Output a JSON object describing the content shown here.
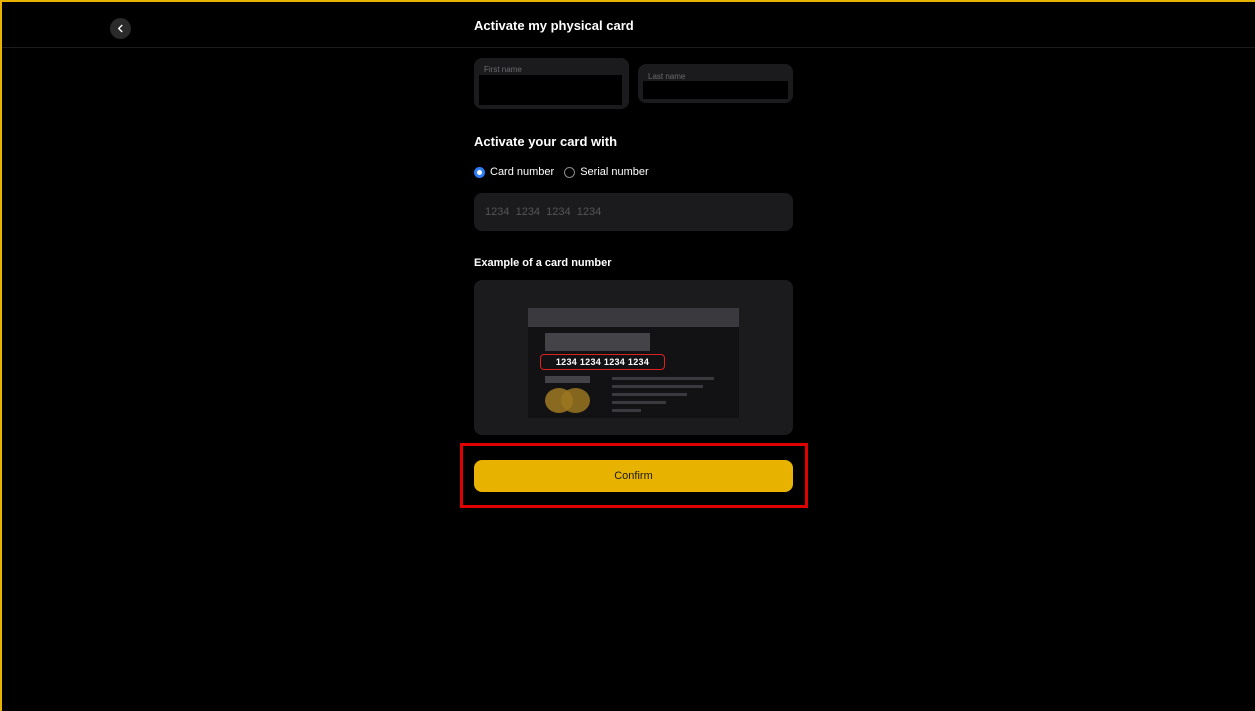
{
  "header": {
    "title": "Activate my physical card",
    "back_icon": "chevron-left-icon"
  },
  "name_fields": {
    "first_name_label": "First name",
    "first_name_value": "",
    "last_name_label": "Last name",
    "last_name_value": ""
  },
  "activation": {
    "section_title": "Activate your card with",
    "options": [
      {
        "label": "Card number",
        "selected": true
      },
      {
        "label": "Serial number",
        "selected": false
      }
    ],
    "card_number_value": "",
    "card_number_placeholder": "1234  1234  1234  1234"
  },
  "example": {
    "title": "Example of a card number",
    "sample_number": "1234 1234 1234 1234"
  },
  "confirm_label": "Confirm",
  "colors": {
    "accent": "#e8b300",
    "radio_selected": "#2e7cf6",
    "highlight": "#e10000"
  }
}
